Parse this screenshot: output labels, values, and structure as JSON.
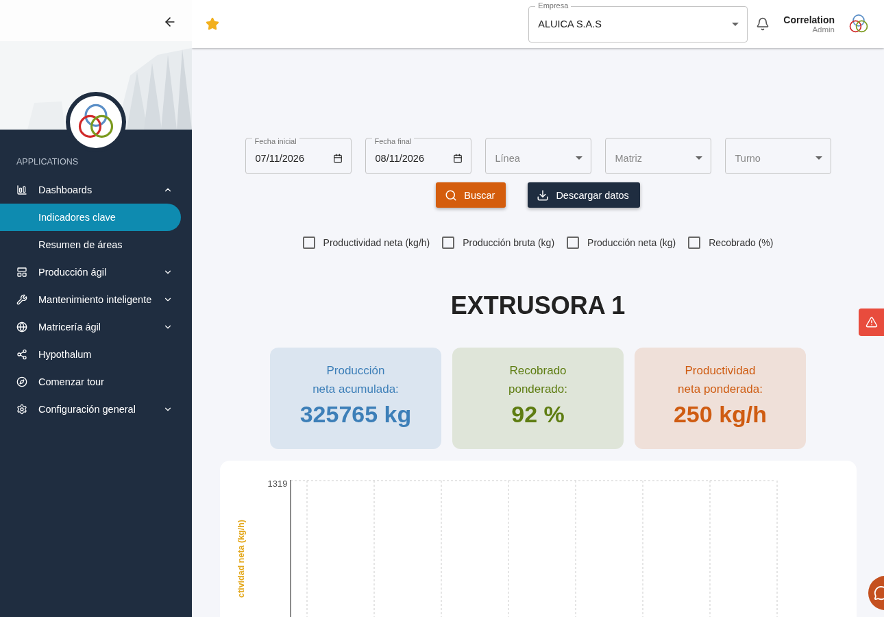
{
  "sidebar": {
    "section": "APPLICATIONS",
    "items": [
      {
        "label": "Dashboards",
        "kind": "group",
        "expanded": true,
        "children": [
          {
            "label": "Indicadores clave",
            "selected": true
          },
          {
            "label": "Resumen de áreas",
            "selected": false
          }
        ]
      },
      {
        "label": "Producción ágil",
        "kind": "group",
        "expanded": false
      },
      {
        "label": "Mantenimiento inteligente",
        "kind": "group",
        "expanded": false
      },
      {
        "label": "Matricería ágil",
        "kind": "group",
        "expanded": false
      },
      {
        "label": "Hypothalum",
        "kind": "link"
      },
      {
        "label": "Comenzar tour",
        "kind": "link"
      },
      {
        "label": "Configuración general",
        "kind": "group",
        "expanded": false
      }
    ]
  },
  "header": {
    "starred": true,
    "company": {
      "label": "Empresa",
      "value": "ALUICA S.A.S"
    },
    "user": {
      "name": "Correlation",
      "role": "Admin"
    }
  },
  "filters": [
    {
      "kind": "date",
      "label": "Fecha inicial",
      "value": "07/11/2026"
    },
    {
      "kind": "date",
      "label": "Fecha final",
      "value": "08/11/2026"
    },
    {
      "kind": "select",
      "placeholder": "Línea"
    },
    {
      "kind": "select",
      "placeholder": "Matriz"
    },
    {
      "kind": "select",
      "placeholder": "Turno"
    }
  ],
  "actions": [
    {
      "kind": "search",
      "label": "Buscar"
    },
    {
      "kind": "download",
      "label": "Descargar datos"
    }
  ],
  "series_toggles": [
    {
      "label": "Productividad neta (kg/h)",
      "checked": false
    },
    {
      "label": "Producción bruta (kg)",
      "checked": false
    },
    {
      "label": "Producción neta (kg)",
      "checked": false
    },
    {
      "label": "Recobrado (%)",
      "checked": false
    }
  ],
  "title": "EXTRUSORA 1",
  "kpis": [
    {
      "label": "Producción\nneta acumulada:",
      "value": "325765 kg",
      "color": "#3d7fb8"
    },
    {
      "label": "Recobrado\nponderado:",
      "value": "92 %",
      "color": "#5e7d12"
    },
    {
      "label": "Productividad\nneta ponderada:",
      "value": "250 kg/h",
      "color": "#cf5c12"
    }
  ],
  "chart": {
    "y_tick": "1319",
    "y_label": "ctividad neta (kg/h)"
  }
}
